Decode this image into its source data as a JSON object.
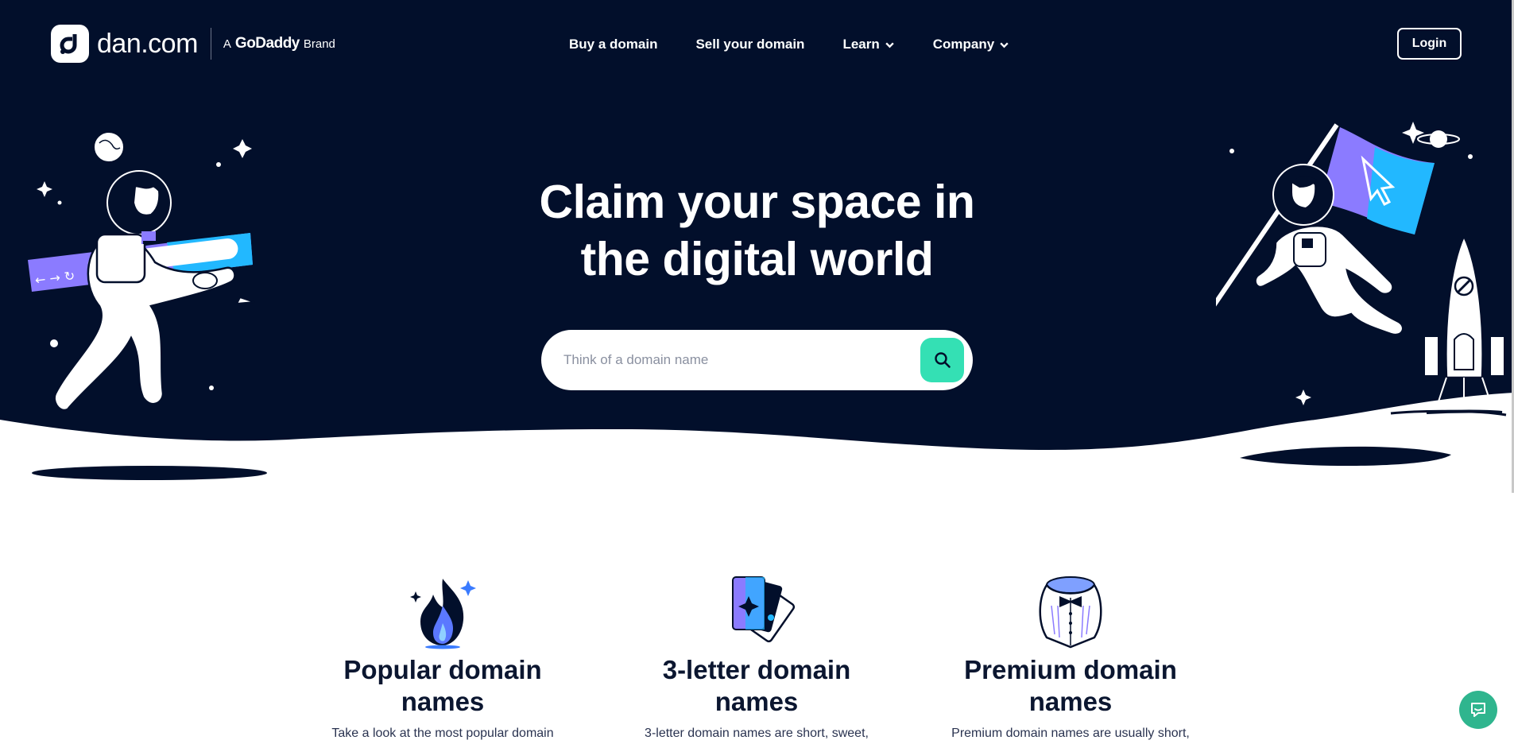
{
  "header": {
    "logo_text": "dan.com",
    "brand_prefix": "A",
    "brand_name": "GoDaddy",
    "brand_suffix": "Brand",
    "nav": [
      {
        "label": "Buy a domain",
        "dropdown": false
      },
      {
        "label": "Sell your domain",
        "dropdown": false
      },
      {
        "label": "Learn",
        "dropdown": true
      },
      {
        "label": "Company",
        "dropdown": true
      }
    ],
    "login_label": "Login"
  },
  "hero": {
    "headline_line1": "Claim your space in",
    "headline_line2": "the digital world",
    "search_placeholder": "Think of a domain name",
    "search_icon": "search-icon"
  },
  "categories": [
    {
      "icon": "flame-icon",
      "title_line1": "Popular domain",
      "title_line2": "names",
      "description": "Take a look at the most popular domain"
    },
    {
      "icon": "playing-cards-icon",
      "title_line1": "3-letter domain",
      "title_line2": "names",
      "description": "3-letter domain names are short, sweet,"
    },
    {
      "icon": "tuxedo-collar-icon",
      "title_line1": "Premium domain",
      "title_line2": "names",
      "description": "Premium domain names are usually short,"
    }
  ],
  "chat": {
    "icon": "chat-icon"
  },
  "colors": {
    "hero_bg": "#020f2b",
    "accent": "#34e0b4",
    "chat": "#2fb58e",
    "text_dark": "#0b1630",
    "purple": "#8b7bff",
    "blue": "#22b8ff"
  }
}
